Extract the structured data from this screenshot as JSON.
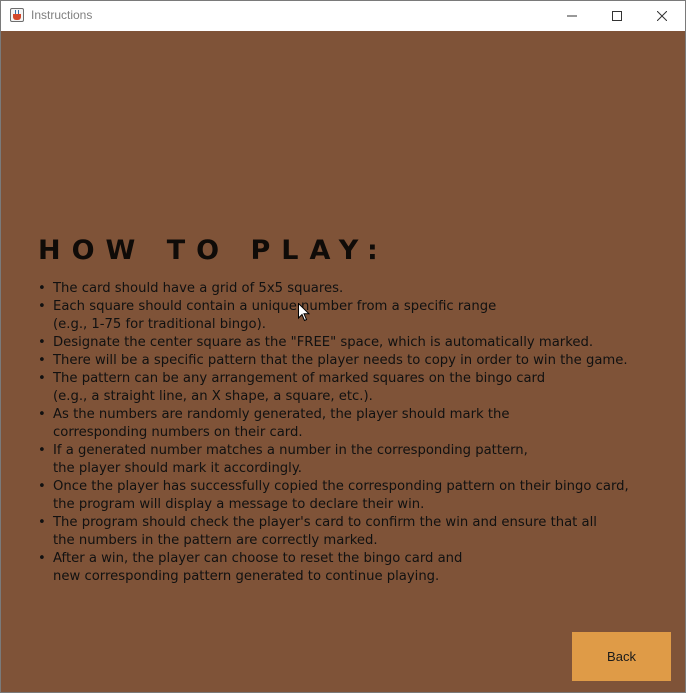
{
  "window": {
    "title": "Instructions"
  },
  "instructions": {
    "heading": "HOW TO PLAY:",
    "rules": [
      {
        "lines": [
          "The card should have a grid of 5x5 squares."
        ]
      },
      {
        "lines": [
          "Each square should contain a unique number from a specific range",
          "(e.g., 1-75 for traditional bingo)."
        ]
      },
      {
        "lines": [
          "Designate the center square as the \"FREE\" space, which is automatically marked."
        ]
      },
      {
        "lines": [
          "There will be a specific pattern that the player needs to copy in order to win the game."
        ]
      },
      {
        "lines": [
          "The pattern can be any arrangement of marked squares on the bingo card",
          "(e.g., a straight line, an X shape, a square, etc.)."
        ]
      },
      {
        "lines": [
          "As the numbers are randomly generated, the player should mark the",
          "corresponding numbers on their card."
        ]
      },
      {
        "lines": [
          "If a generated number matches a number in the corresponding pattern,",
          "the player should mark it accordingly."
        ]
      },
      {
        "lines": [
          "Once the player has successfully copied the corresponding pattern on their bingo card,",
          "the program will display a message to declare their win."
        ]
      },
      {
        "lines": [
          "The program should check the player's card to confirm the win and ensure that all",
          "the numbers in the pattern are correctly marked."
        ]
      },
      {
        "lines": [
          "After a win, the player can choose to reset the bingo card and",
          "new corresponding pattern generated to continue playing."
        ]
      }
    ]
  },
  "footer": {
    "back_label": "Back"
  },
  "colors": {
    "background": "#7f5338",
    "button": "#df9b47",
    "text": "#111111"
  },
  "icons": {
    "app": "java-cup-icon",
    "minimize": "minimize-icon",
    "maximize": "maximize-icon",
    "close": "close-icon",
    "pointer": "mouse-pointer-icon"
  }
}
